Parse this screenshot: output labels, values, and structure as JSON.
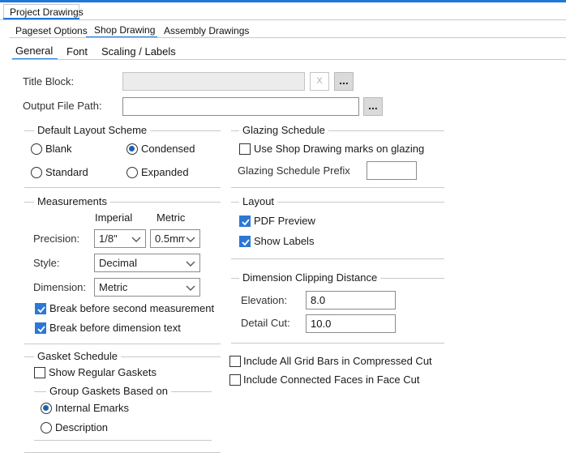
{
  "tabs_outer": {
    "active": "Project Drawings"
  },
  "tabs_sub": {
    "items": [
      "Pageset Options",
      "Shop Drawing",
      "Assembly Drawings"
    ],
    "active_index": 1
  },
  "tabs_inner": {
    "items": [
      "General",
      "Font",
      "Scaling / Labels"
    ],
    "active_index": 0
  },
  "title_block": {
    "label": "Title Block:",
    "value": "",
    "clear_label": "X",
    "browse_label": "..."
  },
  "output_file_path": {
    "label": "Output File Path:",
    "value": "",
    "browse_label": "..."
  },
  "default_layout_scheme": {
    "title": "Default Layout Scheme",
    "options": [
      {
        "label": "Blank",
        "checked": false
      },
      {
        "label": "Condensed",
        "checked": true
      },
      {
        "label": "Standard",
        "checked": false
      },
      {
        "label": "Expanded",
        "checked": false
      }
    ]
  },
  "glazing_schedule": {
    "title": "Glazing Schedule",
    "use_marks_label": "Use Shop Drawing marks on glazing",
    "use_marks_checked": false,
    "prefix_label": "Glazing Schedule Prefix",
    "prefix_value": ""
  },
  "measurements": {
    "title": "Measurements",
    "imperial_header": "Imperial",
    "metric_header": "Metric",
    "precision_label": "Precision:",
    "precision_imperial": "1/8\"",
    "precision_metric": "0.5mm",
    "style_label": "Style:",
    "style_value": "Decimal",
    "dimension_label": "Dimension:",
    "dimension_value": "Metric",
    "break_second_label": "Break before second measurement",
    "break_second_checked": true,
    "break_dimension_label": "Break before dimension text",
    "break_dimension_checked": true
  },
  "layout": {
    "title": "Layout",
    "pdf_preview_label": "PDF Preview",
    "pdf_preview_checked": true,
    "show_labels_label": "Show Labels",
    "show_labels_checked": true
  },
  "dimension_clipping": {
    "title": "Dimension Clipping Distance",
    "elevation_label": "Elevation:",
    "elevation_value": "8.0",
    "detail_cut_label": "Detail Cut:",
    "detail_cut_value": "10.0"
  },
  "gasket_schedule": {
    "title": "Gasket Schedule",
    "show_regular_label": "Show Regular Gaskets",
    "show_regular_checked": false,
    "group_title": "Group Gaskets Based on",
    "options": [
      {
        "label": "Internal Emarks",
        "checked": true
      },
      {
        "label": "Description",
        "checked": false
      }
    ]
  },
  "misc": {
    "include_grid_bars_label": "Include All Grid Bars in Compressed Cut",
    "include_grid_bars_checked": false,
    "include_connected_faces_label": "Include Connected Faces in Face Cut",
    "include_connected_faces_checked": false
  },
  "colors": {
    "accent": "#1e78d7",
    "check_fill": "#2c78d4",
    "radio_dot": "#1b5fb0"
  }
}
